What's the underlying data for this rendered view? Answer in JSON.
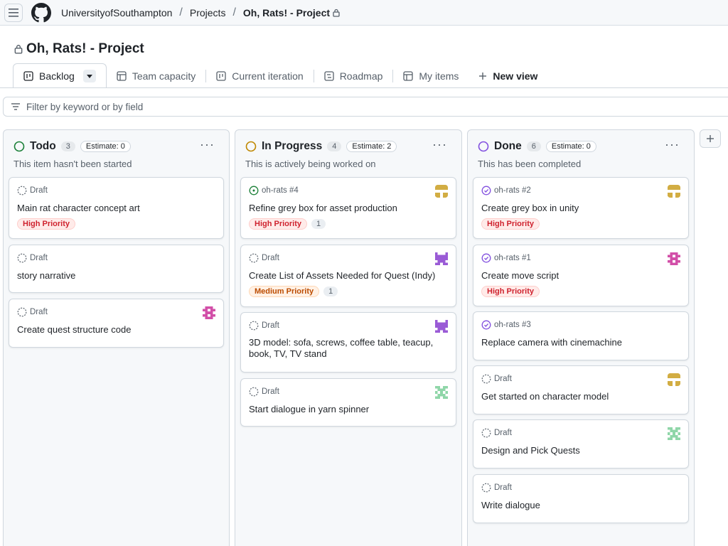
{
  "header": {
    "org": "UniversityofSouthampton",
    "projects": "Projects",
    "project": "Oh, Rats! - Project"
  },
  "page_title": "Oh, Rats! - Project",
  "tabs": [
    {
      "label": "Backlog",
      "active": true,
      "icon": "board-icon"
    },
    {
      "label": "Team capacity",
      "icon": "table-icon"
    },
    {
      "label": "Current iteration",
      "icon": "board-icon"
    },
    {
      "label": "Roadmap",
      "icon": "roadmap-icon"
    },
    {
      "label": "My items",
      "icon": "table-icon"
    }
  ],
  "new_view": "New view",
  "filter": {
    "placeholder": "Filter by keyword or by field"
  },
  "colors": {
    "todo": "#1a7f37",
    "inprogress": "#bf8700",
    "done": "#8250df"
  },
  "columns": [
    {
      "title": "Todo",
      "count": "3",
      "estimate": "Estimate: 0",
      "description": "This item hasn't been started",
      "cards": [
        {
          "meta": "Draft",
          "title": "Main rat character concept art",
          "labels": [
            "High Priority"
          ]
        },
        {
          "meta": "Draft",
          "title": "story narrative"
        },
        {
          "meta": "Draft",
          "title": "Create quest structure code",
          "avatar": "pink"
        }
      ]
    },
    {
      "title": "In Progress",
      "count": "4",
      "estimate": "Estimate: 2",
      "description": "This is actively being worked on",
      "cards": [
        {
          "meta": "oh-rats #4",
          "title": "Refine grey box for asset production",
          "labels": [
            "High Priority"
          ],
          "num": "1",
          "avatar": "gold"
        },
        {
          "meta": "Draft",
          "title": "Create List of Assets Needed for Quest (Indy)",
          "labels": [
            "Medium Priority"
          ],
          "num": "1",
          "avatar": "purple"
        },
        {
          "meta": "Draft",
          "title": "3D model: sofa, screws, coffee table, teacup, book, TV, TV stand",
          "avatar": "purple"
        },
        {
          "meta": "Draft",
          "title": "Start dialogue in yarn spinner",
          "avatar": "green"
        }
      ]
    },
    {
      "title": "Done",
      "count": "6",
      "estimate": "Estimate: 0",
      "description": "This has been completed",
      "cards": [
        {
          "meta": "oh-rats #2",
          "title": "Create grey box in unity",
          "labels": [
            "High Priority"
          ],
          "avatar": "gold"
        },
        {
          "meta": "oh-rats #1",
          "title": "Create move script",
          "labels": [
            "High Priority"
          ],
          "avatar": "pink"
        },
        {
          "meta": "oh-rats #3",
          "title": "Replace camera with cinemachine"
        },
        {
          "meta": "Draft",
          "title": "Get started on character model",
          "avatar": "gold"
        },
        {
          "meta": "Draft",
          "title": "Design and Pick Quests",
          "avatar": "green"
        },
        {
          "meta": "Draft",
          "title": "Write dialogue"
        }
      ]
    }
  ]
}
